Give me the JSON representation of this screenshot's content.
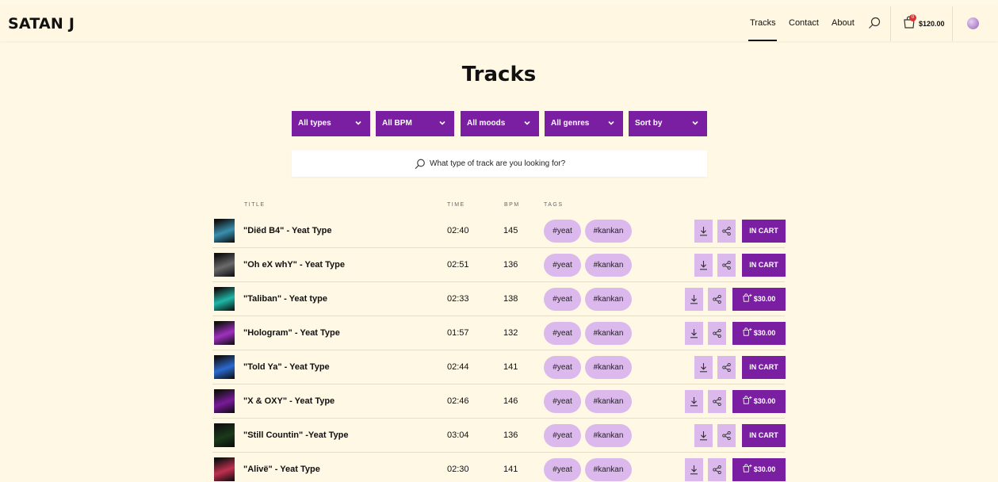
{
  "header": {
    "brand": "SATAN J",
    "nav": [
      "Tracks",
      "Contact",
      "About"
    ],
    "cart_count": "0",
    "cart_total": "$120.00"
  },
  "page": {
    "title": "Tracks",
    "search_placeholder": "What type of track are you looking for?"
  },
  "filters": [
    "All types",
    "All BPM",
    "All moods",
    "All genres",
    "Sort by"
  ],
  "columns": {
    "title": "TITLE",
    "time": "TIME",
    "bpm": "BPM",
    "tags": "TAGS"
  },
  "tracks": [
    {
      "title": "\"Diëd B4\" - Yeat Type",
      "time": "02:40",
      "bpm": "145",
      "tags": [
        "#yeat",
        "#kankan"
      ],
      "action": "IN CART",
      "in_cart": true,
      "thumb": "#3a8fb0"
    },
    {
      "title": "\"Oh eX whY\" - Yeat Type",
      "time": "02:51",
      "bpm": "136",
      "tags": [
        "#yeat",
        "#kankan"
      ],
      "action": "IN CART",
      "in_cart": true,
      "thumb": "#6a6a6a"
    },
    {
      "title": "\"Taliban\" - Yeat type",
      "time": "02:33",
      "bpm": "138",
      "tags": [
        "#yeat",
        "#kankan"
      ],
      "action": "$30.00",
      "in_cart": false,
      "thumb": "#1fb7a8"
    },
    {
      "title": "\"Hologram\" - Yeat Type",
      "time": "01:57",
      "bpm": "132",
      "tags": [
        "#yeat",
        "#kankan"
      ],
      "action": "$30.00",
      "in_cart": false,
      "thumb": "#a030c0"
    },
    {
      "title": "\"Told Ya\" - Yeat Type",
      "time": "02:44",
      "bpm": "141",
      "tags": [
        "#yeat",
        "#kankan"
      ],
      "action": "IN CART",
      "in_cart": true,
      "thumb": "#2a6ad0"
    },
    {
      "title": "\"X & OXY\" - Yeat Type",
      "time": "02:46",
      "bpm": "146",
      "tags": [
        "#yeat",
        "#kankan"
      ],
      "action": "$30.00",
      "in_cart": false,
      "thumb": "#7a1a9a"
    },
    {
      "title": "\"Still Countin\" -Yeat Type",
      "time": "03:04",
      "bpm": "136",
      "tags": [
        "#yeat",
        "#kankan"
      ],
      "action": "IN CART",
      "in_cart": true,
      "thumb": "#1a3a1a"
    },
    {
      "title": "\"Alivë\" - Yeat Type",
      "time": "02:30",
      "bpm": "141",
      "tags": [
        "#yeat",
        "#kankan"
      ],
      "action": "$30.00",
      "in_cart": false,
      "thumb": "#c03050"
    }
  ],
  "colors": {
    "accent": "#7b1fa2",
    "tag_bg": "#dcb9ec",
    "page_bg": "#fff8e5"
  }
}
